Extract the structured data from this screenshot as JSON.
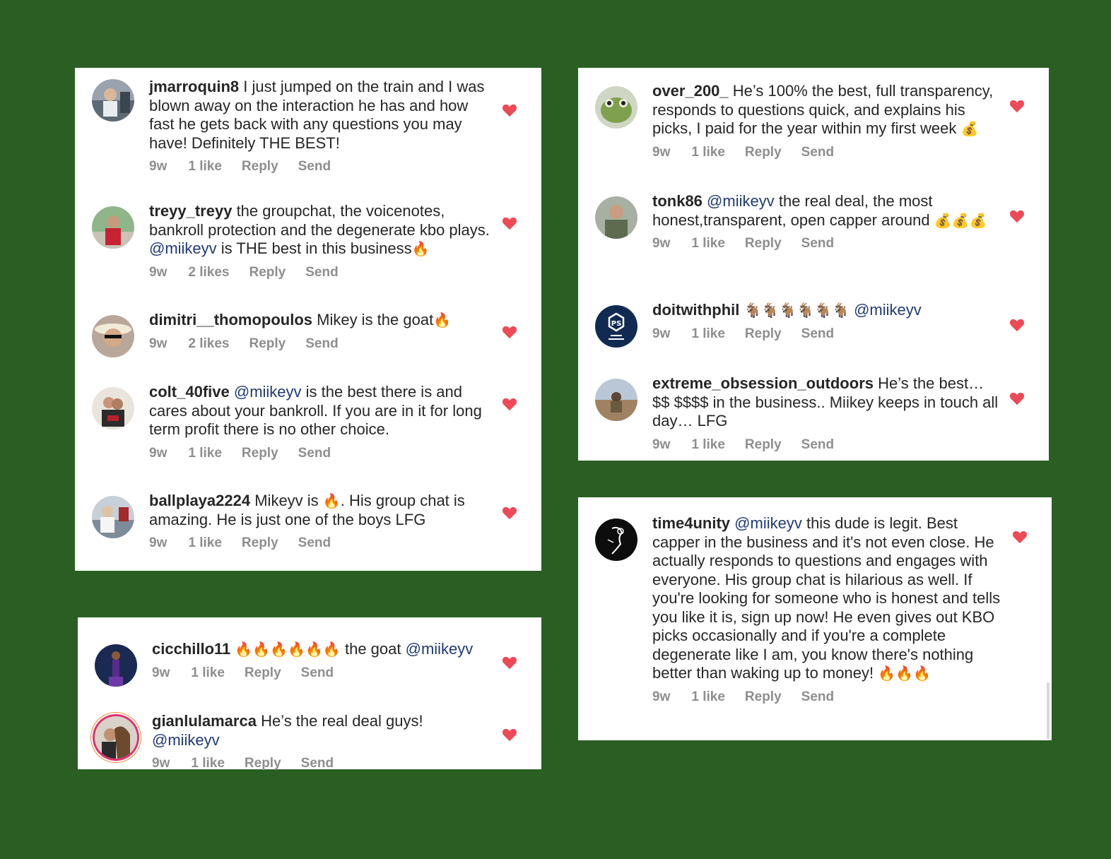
{
  "colors": {
    "background": "#2a5e23",
    "heart": "#ed4956",
    "mention": "#1f3a7a",
    "meta": "#8e8e8e"
  },
  "icons": {
    "like": "heart-icon",
    "fire": "fire-emoji",
    "money": "money-bag-emoji",
    "goat": "goat-emoji"
  },
  "comments": [
    {
      "user": "jmarroquin8",
      "text": "I just jumped on the train and I was blown away on the interaction he has and how fast he gets back with any questions you may have! Definitely THE BEST!",
      "time": "9w",
      "likes": "1 like",
      "reply": "Reply",
      "send": "Send"
    },
    {
      "user": "treyy_treyy",
      "text": "the groupchat, the voicenotes, bankroll protection and the degenerate kbo plays.",
      "mention": "@miikeyv",
      "text2": "is THE best in this business",
      "emoji": "🔥",
      "time": "9w",
      "likes": "2 likes",
      "reply": "Reply",
      "send": "Send"
    },
    {
      "user": "dimitri__thomopoulos",
      "text": "Mikey is the goat",
      "emoji": "🔥",
      "time": "9w",
      "likes": "2 likes",
      "reply": "Reply",
      "send": "Send"
    },
    {
      "user": "colt_40five",
      "mention": "@miikeyv",
      "text": "is the best there is and cares about your bankroll. If you are in it for long term profit there is no other choice.",
      "time": "9w",
      "likes": "1 like",
      "reply": "Reply",
      "send": "Send"
    },
    {
      "user": "ballplaya2224",
      "text": "Mikeyv is",
      "emoji": "🔥",
      "text2": ". His group chat is amazing. He is just one of the boys LFG",
      "time": "9w",
      "likes": "1 like",
      "reply": "Reply",
      "send": "Send"
    },
    {
      "user": "cicchillo11",
      "emoji": "🔥🔥🔥🔥🔥🔥",
      "text": "the goat",
      "mention": "@miikeyv",
      "time": "9w",
      "likes": "1 like",
      "reply": "Reply",
      "send": "Send"
    },
    {
      "user": "gianlulamarca",
      "text": "He’s the real deal guys!",
      "mention": "@miikeyv",
      "time": "9w",
      "likes": "1 like",
      "reply": "Reply",
      "send": "Send"
    },
    {
      "user": "over_200_",
      "text": "He’s 100% the best, full transparency, responds to questions quick, and explains his picks, I paid for the year within my first week",
      "emoji": "💰",
      "time": "9w",
      "likes": "1 like",
      "reply": "Reply",
      "send": "Send"
    },
    {
      "user": "tonk86",
      "mention": "@miikeyv",
      "text": "the real deal, the most honest,transparent, open capper around",
      "emoji": "💰💰💰",
      "time": "9w",
      "likes": "1 like",
      "reply": "Reply",
      "send": "Send"
    },
    {
      "user": "doitwithphil",
      "emoji": "🐐🐐🐐🐐🐐🐐",
      "mention": "@miikeyv",
      "time": "9w",
      "likes": "1 like",
      "reply": "Reply",
      "send": "Send"
    },
    {
      "user": "extreme_obsession_outdoors",
      "text": "He’s the best… $$ $$$$ in the business.. Miikey keeps in touch all day… LFG",
      "time": "9w",
      "likes": "1 like",
      "reply": "Reply",
      "send": "Send"
    },
    {
      "user": "time4unity",
      "mention": "@miikeyv",
      "text": "this dude is legit. Best capper in the business and it's not even close. He actually responds to questions and engages with everyone. His group chat is hilarious as well. If you're looking for someone who is honest and tells you like it is, sign up now! He even gives out KBO picks occasionally and if you're a complete degenerate like I am, you know there's nothing better than waking up to money!",
      "emoji": "🔥🔥🔥",
      "time": "9w",
      "likes": "1 like",
      "reply": "Reply",
      "send": "Send"
    }
  ]
}
